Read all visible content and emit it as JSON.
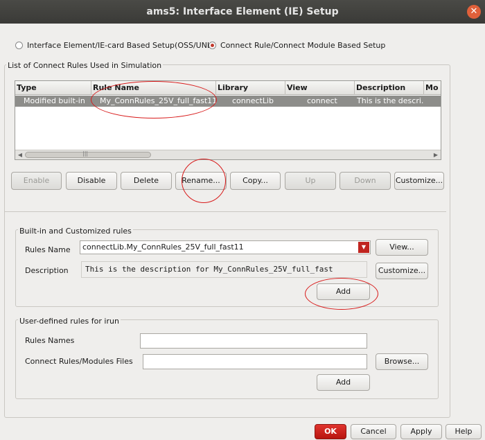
{
  "window": {
    "title": "ams5: Interface Element (IE) Setup",
    "close_glyph": "✕"
  },
  "setup_mode": {
    "options": [
      {
        "label": "Interface Element/IE-card Based Setup(OSS/UNL)",
        "selected": false
      },
      {
        "label": "Connect Rule/Connect Module Based Setup",
        "selected": true
      }
    ]
  },
  "connect_rules": {
    "group_label": "List of Connect Rules Used in Simulation",
    "columns": [
      "Type",
      "Rule Name",
      "Library",
      "View",
      "Description",
      "Mo"
    ],
    "rows": [
      {
        "type": "Modified built-in",
        "rule_name": "My_ConnRules_25V_full_fast11",
        "library": "connectLib",
        "view": "connect",
        "description": "This is the descri..."
      }
    ],
    "scroll_left": "◀",
    "scroll_right": "▶",
    "scroll_grip": "|||",
    "buttons": {
      "enable": "Enable",
      "disable": "Disable",
      "delete": "Delete",
      "rename": "Rename...",
      "copy": "Copy...",
      "up": "Up",
      "down": "Down",
      "customize": "Customize..."
    }
  },
  "builtin": {
    "group_label": "Built-in and Customized rules",
    "rules_name_label": "Rules Name",
    "rules_name_value": "connectLib.My_ConnRules_25V_full_fast11",
    "combo_arrow": "▼",
    "view_button": "View...",
    "description_label": "Description",
    "description_value": "This is the description for My_ConnRules_25V_full_fast",
    "customize_button": "Customize...",
    "add_button": "Add"
  },
  "user_defined": {
    "group_label": "User-defined rules for irun",
    "rules_names_label": "Rules Names",
    "rules_names_value": "",
    "files_label": "Connect Rules/Modules Files",
    "files_value": "",
    "browse_button": "Browse...",
    "add_button": "Add"
  },
  "dialog_buttons": {
    "ok": "OK",
    "cancel": "Cancel",
    "apply": "Apply",
    "help": "Help"
  },
  "colors": {
    "accent": "#c0251f",
    "selection_row": "#8d8d8a",
    "annotation": "#d81a1a"
  }
}
